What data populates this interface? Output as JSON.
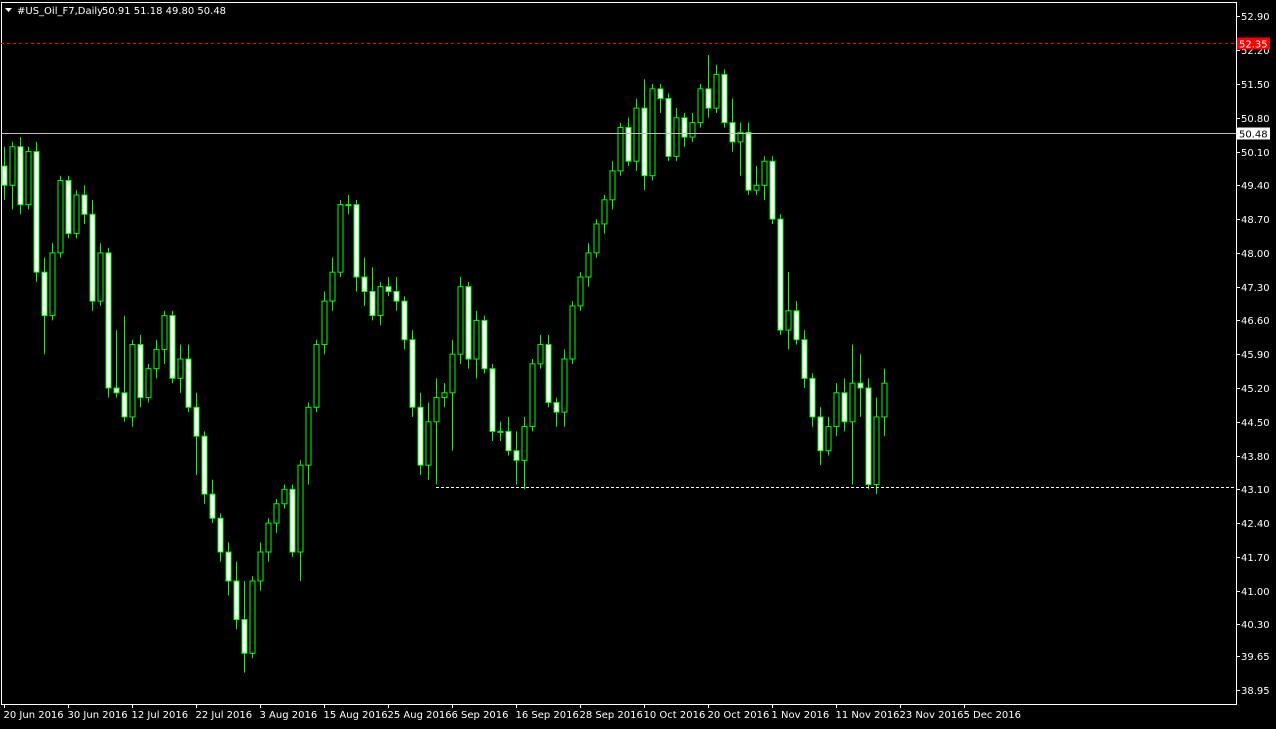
{
  "header": {
    "symbol_timeframe": "#US_Oil_F7,Daily",
    "ohlc": "50.91 51.18 49.80 50.48",
    "dropdown_icon": "triangle-down-icon"
  },
  "colors": {
    "background": "#000000",
    "candle": "#00ff00",
    "bull_body": "#000000",
    "bear_body": "#ffffff",
    "axis": "#ffffff",
    "current_line": "#c0c0c0",
    "ask_line": "#ff0000",
    "current_tag_bg": "#ffffff",
    "current_tag_text": "#000000",
    "ask_tag_bg": "#ff0000",
    "ask_tag_text": "#ffffff",
    "support_line": "#ffffff"
  },
  "chart_data": {
    "type": "candlestick",
    "ylim": [
      38.65,
      53.2
    ],
    "y_ticks": [
      "52.90",
      "52.20",
      "51.50",
      "50.80",
      "50.10",
      "49.40",
      "48.70",
      "48.00",
      "47.30",
      "46.60",
      "45.90",
      "45.20",
      "44.50",
      "43.80",
      "43.10",
      "42.40",
      "41.70",
      "41.00",
      "40.30",
      "39.65",
      "38.95"
    ],
    "x_ticks": [
      {
        "label": "20 Jun 2016",
        "bar": 0
      },
      {
        "label": "30 Jun 2016",
        "bar": 8
      },
      {
        "label": "12 Jul 2016",
        "bar": 16
      },
      {
        "label": "22 Jul 2016",
        "bar": 24
      },
      {
        "label": "3 Aug 2016",
        "bar": 32
      },
      {
        "label": "15 Aug 2016",
        "bar": 40
      },
      {
        "label": "25 Aug 2016",
        "bar": 48
      },
      {
        "label": "6 Sep 2016",
        "bar": 56
      },
      {
        "label": "16 Sep 2016",
        "bar": 64
      },
      {
        "label": "28 Sep 2016",
        "bar": 72
      },
      {
        "label": "10 Oct 2016",
        "bar": 80
      },
      {
        "label": "20 Oct 2016",
        "bar": 88
      },
      {
        "label": "1 Nov 2016",
        "bar": 96
      },
      {
        "label": "11 Nov 2016",
        "bar": 104
      },
      {
        "label": "23 Nov 2016",
        "bar": 112
      },
      {
        "label": "5 Dec 2016",
        "bar": 120
      }
    ],
    "current_price": "50.48",
    "current_price_value": 50.48,
    "ask_price": "52.35",
    "ask_price_value": 52.35,
    "support_level": 43.15,
    "support_from_bar": 54,
    "candles": [
      [
        49.8,
        50.2,
        49.1,
        49.4
      ],
      [
        49.4,
        50.3,
        48.9,
        50.2
      ],
      [
        50.2,
        50.4,
        48.8,
        49.0
      ],
      [
        49.0,
        50.2,
        48.9,
        50.1
      ],
      [
        50.1,
        50.3,
        47.4,
        47.6
      ],
      [
        47.6,
        47.9,
        45.9,
        46.7
      ],
      [
        46.7,
        48.2,
        46.6,
        48.0
      ],
      [
        48.0,
        49.6,
        47.9,
        49.5
      ],
      [
        49.5,
        49.6,
        48.3,
        48.4
      ],
      [
        48.4,
        49.3,
        48.3,
        49.2
      ],
      [
        49.2,
        49.4,
        48.6,
        48.8
      ],
      [
        48.8,
        49.1,
        46.8,
        47.0
      ],
      [
        47.0,
        48.2,
        46.9,
        48.0
      ],
      [
        48.0,
        48.1,
        45.0,
        45.2
      ],
      [
        45.2,
        46.4,
        45.0,
        45.1
      ],
      [
        45.1,
        46.7,
        44.5,
        44.6
      ],
      [
        44.6,
        46.2,
        44.4,
        46.1
      ],
      [
        46.1,
        46.3,
        44.8,
        45.0
      ],
      [
        45.0,
        45.7,
        44.9,
        45.6
      ],
      [
        45.6,
        46.2,
        45.4,
        46.0
      ],
      [
        46.0,
        46.8,
        45.7,
        46.7
      ],
      [
        46.7,
        46.8,
        45.3,
        45.4
      ],
      [
        45.4,
        46.1,
        45.1,
        45.8
      ],
      [
        45.8,
        46.1,
        44.7,
        44.8
      ],
      [
        44.8,
        45.1,
        43.4,
        44.2
      ],
      [
        44.2,
        44.3,
        42.8,
        43.0
      ],
      [
        43.0,
        43.3,
        42.4,
        42.5
      ],
      [
        42.5,
        42.6,
        41.6,
        41.8
      ],
      [
        41.8,
        42.0,
        40.9,
        41.2
      ],
      [
        41.2,
        41.6,
        40.2,
        40.4
      ],
      [
        40.4,
        41.2,
        39.3,
        39.7
      ],
      [
        39.7,
        41.3,
        39.6,
        41.2
      ],
      [
        41.2,
        42.0,
        41.0,
        41.8
      ],
      [
        41.8,
        42.5,
        41.6,
        42.4
      ],
      [
        42.4,
        42.9,
        42.2,
        42.8
      ],
      [
        42.8,
        43.2,
        42.7,
        43.1
      ],
      [
        43.1,
        43.2,
        41.7,
        41.8
      ],
      [
        41.8,
        43.7,
        41.2,
        43.6
      ],
      [
        43.6,
        44.9,
        43.2,
        44.8
      ],
      [
        44.8,
        46.2,
        44.7,
        46.1
      ],
      [
        46.1,
        47.2,
        45.9,
        47.0
      ],
      [
        47.0,
        47.9,
        46.8,
        47.6
      ],
      [
        47.6,
        49.1,
        47.5,
        49.0
      ],
      [
        49.0,
        49.2,
        48.8,
        49.0
      ],
      [
        49.0,
        49.1,
        47.2,
        47.5
      ],
      [
        47.5,
        47.9,
        46.9,
        47.2
      ],
      [
        47.2,
        47.7,
        46.6,
        46.7
      ],
      [
        46.7,
        47.4,
        46.5,
        47.3
      ],
      [
        47.3,
        47.5,
        47.1,
        47.2
      ],
      [
        47.2,
        47.5,
        46.8,
        47.0
      ],
      [
        47.0,
        47.1,
        46.0,
        46.2
      ],
      [
        46.2,
        46.4,
        44.6,
        44.8
      ],
      [
        44.8,
        45.1,
        43.4,
        43.6
      ],
      [
        43.6,
        44.9,
        43.3,
        44.5
      ],
      [
        44.5,
        45.4,
        43.2,
        45.0
      ],
      [
        45.0,
        45.3,
        44.8,
        45.1
      ],
      [
        45.1,
        46.2,
        43.9,
        45.9
      ],
      [
        45.9,
        47.5,
        45.7,
        47.3
      ],
      [
        47.3,
        47.4,
        45.6,
        45.8
      ],
      [
        45.8,
        46.8,
        45.4,
        46.6
      ],
      [
        46.6,
        46.7,
        45.5,
        45.6
      ],
      [
        45.6,
        45.7,
        44.1,
        44.3
      ],
      [
        44.3,
        44.5,
        44.1,
        44.3
      ],
      [
        44.3,
        44.6,
        43.8,
        43.9
      ],
      [
        43.9,
        44.3,
        43.2,
        43.7
      ],
      [
        43.7,
        44.6,
        43.1,
        44.4
      ],
      [
        44.4,
        45.8,
        44.3,
        45.7
      ],
      [
        45.7,
        46.3,
        45.6,
        46.1
      ],
      [
        46.1,
        46.3,
        44.8,
        44.9
      ],
      [
        44.9,
        45.0,
        44.4,
        44.7
      ],
      [
        44.7,
        46.0,
        44.4,
        45.8
      ],
      [
        45.8,
        47.0,
        45.7,
        46.9
      ],
      [
        46.9,
        47.6,
        46.8,
        47.5
      ],
      [
        47.5,
        48.2,
        47.3,
        48.0
      ],
      [
        48.0,
        48.7,
        47.9,
        48.6
      ],
      [
        48.6,
        49.2,
        48.4,
        49.1
      ],
      [
        49.1,
        49.9,
        48.9,
        49.7
      ],
      [
        49.7,
        50.7,
        49.6,
        50.6
      ],
      [
        50.6,
        50.8,
        49.8,
        49.9
      ],
      [
        49.9,
        51.2,
        49.7,
        51.0
      ],
      [
        51.0,
        51.6,
        49.3,
        49.6
      ],
      [
        49.6,
        51.5,
        49.5,
        51.4
      ],
      [
        51.4,
        51.5,
        50.9,
        51.2
      ],
      [
        51.2,
        51.3,
        49.9,
        50.0
      ],
      [
        50.0,
        51.0,
        49.9,
        50.8
      ],
      [
        50.8,
        50.9,
        50.2,
        50.4
      ],
      [
        50.4,
        50.9,
        50.3,
        50.7
      ],
      [
        50.7,
        51.5,
        50.6,
        51.4
      ],
      [
        51.4,
        52.1,
        50.8,
        51.0
      ],
      [
        51.0,
        51.9,
        50.9,
        51.7
      ],
      [
        51.7,
        51.8,
        50.6,
        50.7
      ],
      [
        50.7,
        51.2,
        50.1,
        50.3
      ],
      [
        50.3,
        50.7,
        49.6,
        50.5
      ],
      [
        50.5,
        50.7,
        49.2,
        49.3
      ],
      [
        49.3,
        49.8,
        49.2,
        49.4
      ],
      [
        49.4,
        50.0,
        49.1,
        49.9
      ],
      [
        49.9,
        50.0,
        48.6,
        48.7
      ],
      [
        48.7,
        48.8,
        46.3,
        46.4
      ],
      [
        46.4,
        47.6,
        46.0,
        46.8
      ],
      [
        46.8,
        47.0,
        46.1,
        46.2
      ],
      [
        46.2,
        46.4,
        45.2,
        45.4
      ],
      [
        45.4,
        45.5,
        44.4,
        44.6
      ],
      [
        44.6,
        44.8,
        43.6,
        43.9
      ],
      [
        43.9,
        44.6,
        43.8,
        44.4
      ],
      [
        44.4,
        45.3,
        44.2,
        45.1
      ],
      [
        45.1,
        45.4,
        44.3,
        44.5
      ],
      [
        44.5,
        46.1,
        43.2,
        45.3
      ],
      [
        45.3,
        45.9,
        44.6,
        45.2
      ],
      [
        45.2,
        45.4,
        43.1,
        43.2
      ],
      [
        43.2,
        45.0,
        43.0,
        44.6
      ],
      [
        44.6,
        45.6,
        44.2,
        45.3
      ]
    ]
  }
}
